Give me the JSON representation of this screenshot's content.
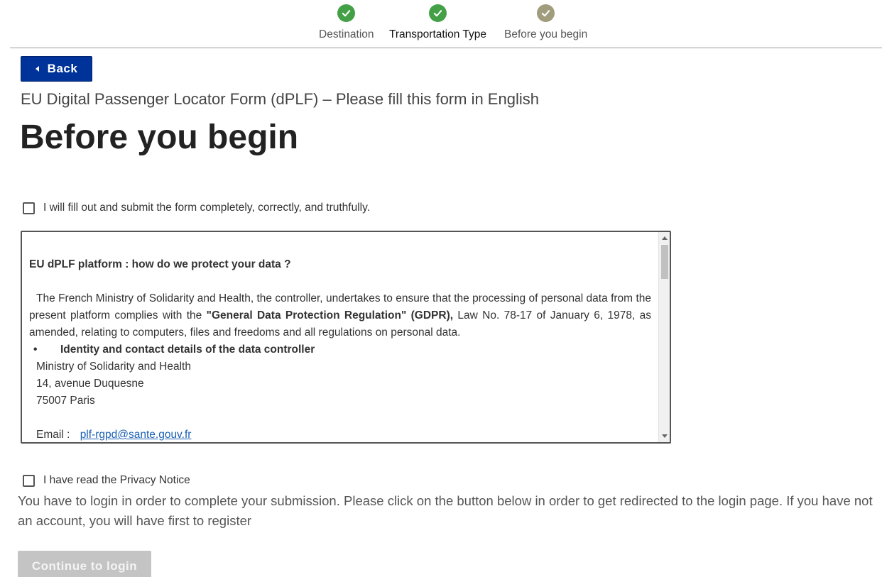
{
  "stepper": {
    "steps": [
      {
        "label": "Destination",
        "status": "complete",
        "color": "#43a047"
      },
      {
        "label": "Transportation Type",
        "status": "complete",
        "color": "#43a047"
      },
      {
        "label": "Before you begin",
        "status": "current",
        "color": "#a09c7c"
      }
    ]
  },
  "header": {
    "back_label": "Back",
    "subtitle": "EU Digital Passenger Locator Form (dPLF) – Please fill this form in English",
    "title": "Before you begin"
  },
  "form": {
    "commit_checkbox_label": "I will fill out and submit the form completely, correctly, and truthfully.",
    "commit_checked": false,
    "privacy_checkbox_label": "I have read the Privacy Notice",
    "privacy_checked": false
  },
  "privacy_notice": {
    "heading": "EU dPLF platform : how do we protect your data ?",
    "para_start": "The French Ministry of Solidarity and Health, the controller, undertakes to ensure that the processing of personal data from the present platform complies with the ",
    "para_bold": "\"General Data Protection Regulation\" (GDPR),",
    "para_end": " Law No. 78-17 of January 6, 1978, as amended, relating to computers, files and freedoms and all regulations on personal data.",
    "bullet_heading": "Identity and contact details of the data controller",
    "address_lines": [
      "Ministry of Solidarity and Health",
      "14, avenue Duquesne",
      "75007 Paris"
    ],
    "email_label": "Email :",
    "email": "plf-rgpd@sante.gouv.fr"
  },
  "login_note": "You have to login in order to complete your submission. Please click on the button below in order to get redirected to the login page. If you have not an account, you will have first to register",
  "continue_label": "Continue to login",
  "colors": {
    "primary": "#003399",
    "disabled": "#c4c4c4",
    "link": "#1a5fb4"
  }
}
